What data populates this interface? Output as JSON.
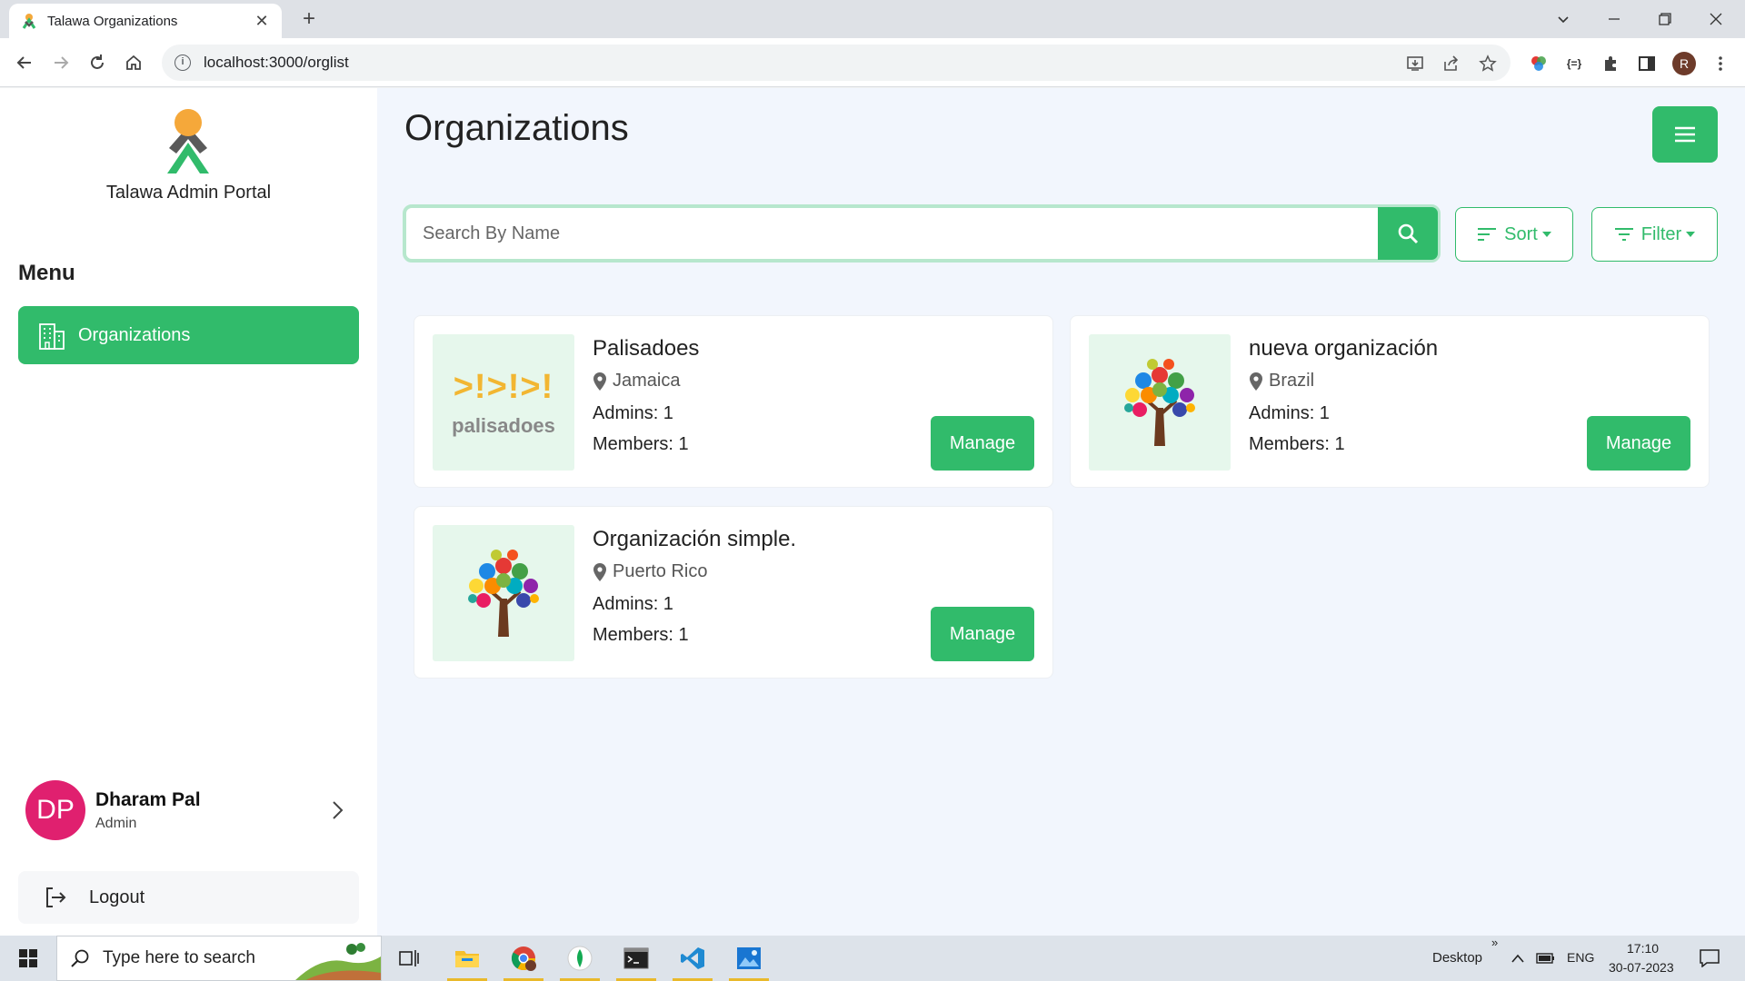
{
  "browser": {
    "tab_title": "Talawa Organizations",
    "tab_close": "✕",
    "new_tab": "+",
    "url": "localhost:3000/orglist",
    "profile_initial": "R"
  },
  "sidebar": {
    "portal_name": "Talawa Admin Portal",
    "menu_title": "Menu",
    "items": [
      {
        "label": "Organizations",
        "icon": "building-icon",
        "active": true
      }
    ],
    "user": {
      "initials": "DP",
      "name": "Dharam Pal",
      "role": "Admin"
    },
    "logout_label": "Logout"
  },
  "main": {
    "title": "Organizations",
    "search_placeholder": "Search By Name",
    "sort_label": "Sort",
    "filter_label": "Filter"
  },
  "orgs": [
    {
      "name": "Palisadoes",
      "location": "Jamaica",
      "admins": "Admins: 1",
      "members": "Members: 1",
      "manage": "Manage",
      "logo_text": "palisadoes",
      "logo_mark": ">!>!>!"
    },
    {
      "name": "nueva organización",
      "location": "Brazil",
      "admins": "Admins: 1",
      "members": "Members: 1",
      "manage": "Manage"
    },
    {
      "name": "Organización simple.",
      "location": "Puerto Rico",
      "admins": "Admins: 1",
      "members": "Members: 1",
      "manage": "Manage"
    }
  ],
  "taskbar": {
    "search_placeholder": "Type here to search",
    "desktop_label": "Desktop",
    "lang": "ENG",
    "time": "17:10",
    "date": "30-07-2023"
  },
  "colors": {
    "accent": "#31bb6b",
    "avatar": "#e0206f",
    "main_bg": "#f2f6fd"
  }
}
